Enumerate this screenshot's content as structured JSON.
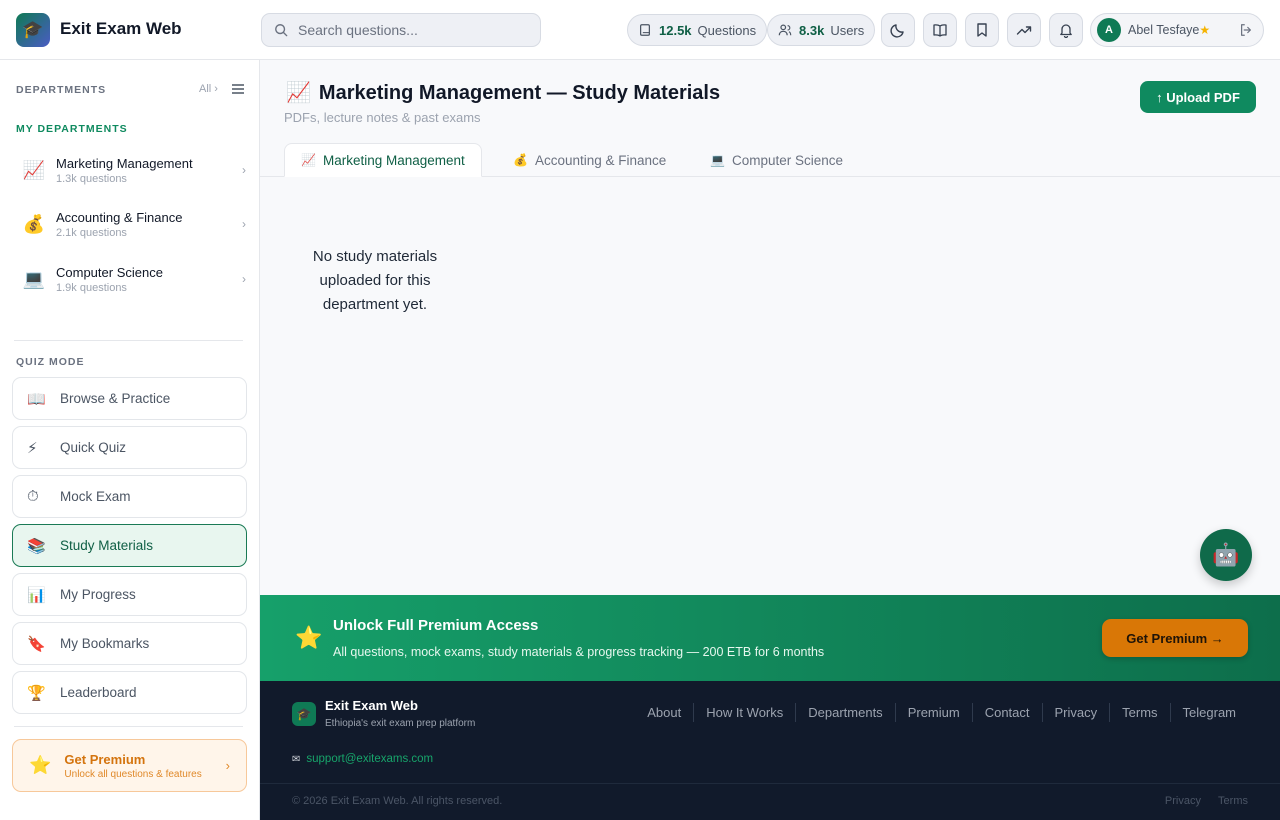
{
  "header": {
    "logo_emoji": "🎓",
    "brand": "Exit Exam Web",
    "search_placeholder": "Search questions...",
    "questions_count": "12.5k",
    "questions_label": "Questions",
    "users_count": "8.3k",
    "users_label": "Users",
    "user_initial": "A",
    "user_name": "Abel Tesfaye",
    "user_badge": "★"
  },
  "sidebar": {
    "departments_label": "DEPARTMENTS",
    "all_link": "All ›",
    "my_departments_label": "MY DEPARTMENTS",
    "departments": [
      {
        "emoji": "📈",
        "name": "Marketing Management",
        "count": "1.3k questions"
      },
      {
        "emoji": "💰",
        "name": "Accounting & Finance",
        "count": "2.1k questions"
      },
      {
        "emoji": "💻",
        "name": "Computer Science",
        "count": "1.9k questions"
      }
    ],
    "quiz_mode_label": "QUIZ MODE",
    "quiz_modes": [
      {
        "emoji": "📖",
        "label": "Browse & Practice"
      },
      {
        "emoji": "⚡",
        "label": "Quick Quiz"
      },
      {
        "emoji": "⏱",
        "label": "Mock Exam"
      },
      {
        "emoji": "📚",
        "label": "Study Materials"
      },
      {
        "emoji": "📊",
        "label": "My Progress"
      },
      {
        "emoji": "🔖",
        "label": "My Bookmarks"
      },
      {
        "emoji": "🏆",
        "label": "Leaderboard"
      }
    ],
    "premium_title": "Get Premium",
    "premium_sub": "Unlock all questions & features",
    "premium_emoji": "⭐"
  },
  "main": {
    "title_emoji": "📈",
    "title": "Marketing Management — Study Materials",
    "subtitle": "PDFs, lecture notes & past exams",
    "upload_label": "↑ Upload PDF",
    "tabs": [
      {
        "emoji": "📈",
        "label": "Marketing Management"
      },
      {
        "emoji": "💰",
        "label": "Accounting & Finance"
      },
      {
        "emoji": "💻",
        "label": "Computer Science"
      }
    ],
    "empty_message": "No study materials uploaded for this department yet.",
    "chatbot_emoji": "🤖"
  },
  "banner": {
    "emoji": "⭐",
    "title": "Unlock Full Premium Access",
    "subtitle": "All questions, mock exams, study materials & progress tracking — 200 ETB for 6 months",
    "button": "Get Premium →"
  },
  "footer": {
    "brand": "Exit Exam Web",
    "tagline": "Ethiopia's exit exam prep platform",
    "links": [
      "About",
      "How It Works",
      "Departments",
      "Premium",
      "Contact",
      "Privacy",
      "Terms",
      "Telegram"
    ],
    "email": "support@exitexams.com",
    "copyright": "© 2026 Exit Exam Web. All rights reserved.",
    "bottom_links": [
      "Privacy",
      "Terms"
    ]
  },
  "colors": {
    "primary": "#0f8a5f",
    "premium": "#d97706",
    "footer_bg": "#111a2b"
  }
}
